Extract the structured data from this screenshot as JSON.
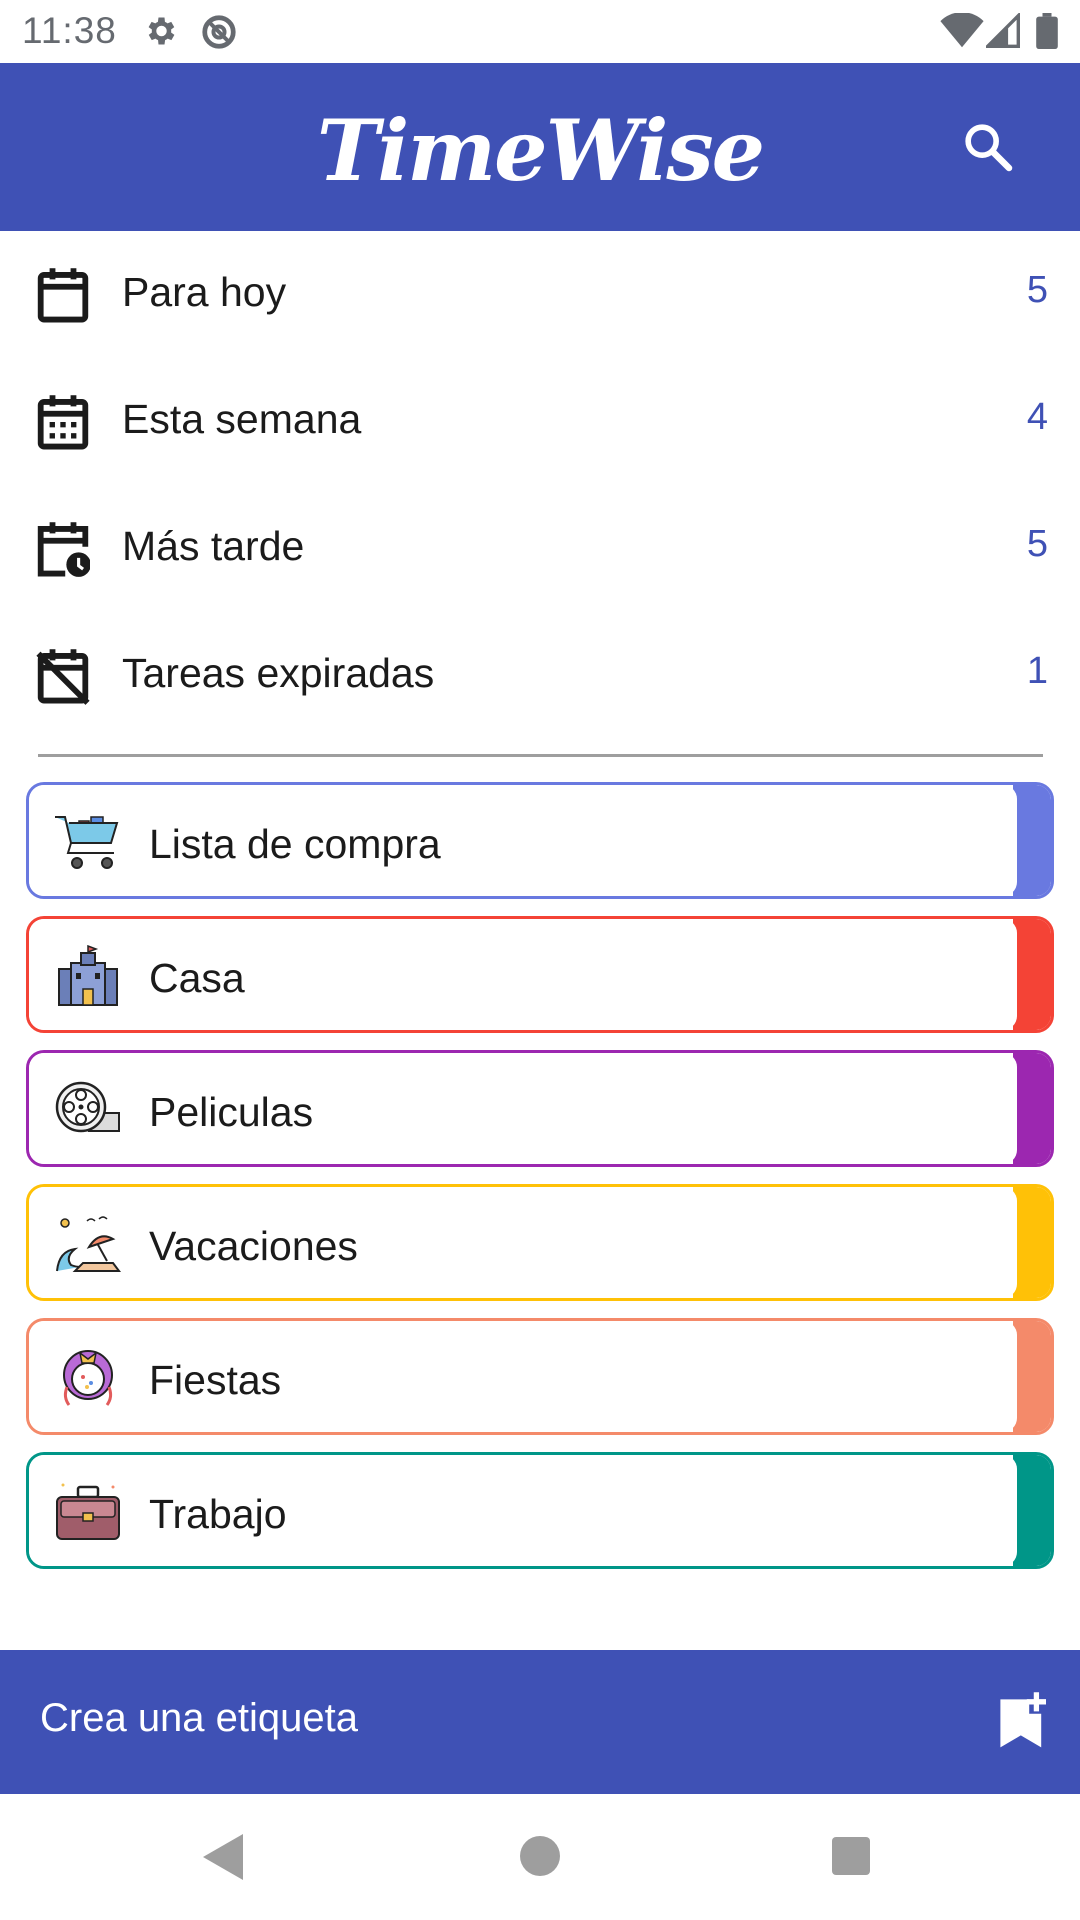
{
  "status_bar": {
    "time": "11:38",
    "icons": [
      "gear-icon",
      "at-sign-icon",
      "wifi-icon",
      "signal-icon",
      "battery-icon"
    ]
  },
  "app_bar": {
    "title": "TimeWise",
    "search_icon": "search-icon"
  },
  "summary": [
    {
      "label": "Para hoy",
      "count": "5",
      "icon": "calendar-today-icon"
    },
    {
      "label": "Esta semana",
      "count": "4",
      "icon": "calendar-week-icon"
    },
    {
      "label": "Más tarde",
      "count": "5",
      "icon": "calendar-clock-icon"
    },
    {
      "label": "Tareas expiradas",
      "count": "1",
      "icon": "calendar-off-icon"
    }
  ],
  "labels": [
    {
      "name": "Lista de compra",
      "color": "#6979e0",
      "icon": "shopping-cart-icon"
    },
    {
      "name": "Casa",
      "color": "#f44336",
      "icon": "castle-icon"
    },
    {
      "name": "Peliculas",
      "color": "#9c27b0",
      "icon": "film-reel-icon"
    },
    {
      "name": "Vacaciones",
      "color": "#ffc107",
      "icon": "beach-icon"
    },
    {
      "name": "Fiestas",
      "color": "#f48a6a",
      "icon": "party-wreath-icon"
    },
    {
      "name": "Trabajo",
      "color": "#009688",
      "icon": "briefcase-icon"
    }
  ],
  "create_bar": {
    "label": "Crea una etiqueta",
    "icon": "bookmark-add-icon"
  },
  "colors": {
    "primary": "#3f51b5",
    "count_text": "#3f51b5"
  }
}
